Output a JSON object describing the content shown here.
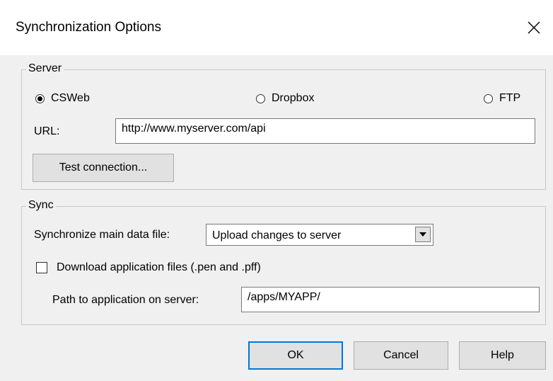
{
  "dialog": {
    "title": "Synchronization Options"
  },
  "server_group": {
    "label": "Server",
    "options": [
      {
        "label": "CSWeb",
        "checked": true
      },
      {
        "label": "Dropbox",
        "checked": false
      },
      {
        "label": "FTP",
        "checked": false
      }
    ],
    "url_label": "URL:",
    "url_value": "http://www.myserver.com/api",
    "test_button": "Test connection..."
  },
  "sync_group": {
    "label": "Sync",
    "main_file_label": "Synchronize main data file:",
    "main_file_value": "Upload changes to server",
    "download_label": "Download application files (.pen and .pff)",
    "download_checked": false,
    "path_label": "Path to application on server:",
    "path_value": "/apps/MYAPP/"
  },
  "buttons": {
    "ok": "OK",
    "cancel": "Cancel",
    "help": "Help"
  },
  "icons": {
    "close": "close-icon",
    "dropdown": "dropdown-arrow-icon"
  }
}
